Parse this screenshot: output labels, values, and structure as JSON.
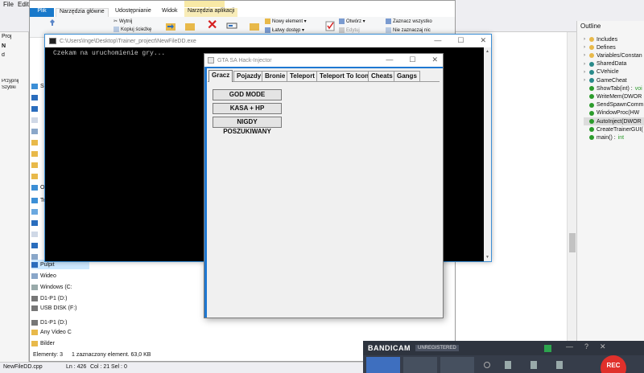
{
  "ide": {
    "menu": [
      "File",
      "Edit"
    ],
    "left_tabs": [
      "Proj",
      "N",
      "d",
      "Przypnij",
      "Szybki"
    ],
    "status": {
      "file": "NewFileDD.cpp",
      "line": "Ln : 426",
      "col": "Col : 21",
      "sel": "Sel : 0"
    }
  },
  "outline": {
    "title": "Outline",
    "items": [
      {
        "label": "Includes",
        "type": "folder"
      },
      {
        "label": "Defines",
        "type": "folder"
      },
      {
        "label": "Variables/Constan",
        "type": "folder"
      },
      {
        "label": "SharedData",
        "type": "struct"
      },
      {
        "label": "CVehicle",
        "type": "struct"
      },
      {
        "label": "GameCheat",
        "type": "struct"
      },
      {
        "label": "ShowTab(int) :",
        "ret": "voi",
        "type": "func"
      },
      {
        "label": "WriteMem(DWOR",
        "type": "func"
      },
      {
        "label": "SendSpawnComm",
        "type": "func"
      },
      {
        "label": "WindowProc(HW",
        "type": "func"
      },
      {
        "label": "AutoInject(DWOR",
        "type": "func",
        "selected": true
      },
      {
        "label": "CreateTrainerGUI(",
        "type": "func"
      },
      {
        "label": "main() :",
        "ret": "int",
        "type": "func"
      }
    ]
  },
  "explorer": {
    "ribbon_tabs": {
      "file": "Plik",
      "home": "Narzędzia główne",
      "share": "Udostępnianie",
      "view": "Widok",
      "apps": "Narzędzia aplikacji"
    },
    "ribbon": {
      "cut": "Wytnij",
      "copy_path": "Kopiuj ścieżkę",
      "new_item": "Nowy element ▾",
      "easy_access": "Łatwy dostęp ▾",
      "open": "Otwórz ▾",
      "edit": "Edytuj",
      "select_all": "Zaznacz wszystko",
      "select_none": "Nie zaznaczaj nic"
    },
    "nav": [
      {
        "label": "Sa",
        "top": 0
      },
      {
        "label": "O",
        "top": 0
      },
      {
        "label": "Te",
        "top": 0
      },
      {
        "label": "Pulpit",
        "top": 0,
        "selected": true
      },
      {
        "label": "Wideo",
        "top": 0
      },
      {
        "label": "Windows (C:",
        "top": 0
      },
      {
        "label": "D1-P1 (D:)",
        "top": 0
      },
      {
        "label": "USB DISK (F:)",
        "top": 0
      },
      {
        "label": "D1-P1 (D:)",
        "top": 0
      },
      {
        "label": "Any Video C",
        "top": 0
      },
      {
        "label": "Bilder",
        "top": 0
      }
    ],
    "status": {
      "count": "Elementy: 3",
      "selected": "1 zaznaczony element. 63,0 KB"
    }
  },
  "console": {
    "title": "C:\\Users\\Inge\\Desktop\\Trainer_project\\NewFileDD.exe",
    "output": "Czekam na uruchomienie gry...",
    "buttons": {
      "minimize": "—",
      "maximize": "☐",
      "close": "✕"
    }
  },
  "injector": {
    "title": "GTA SA Hack-Injector",
    "buttons_window": {
      "minimize": "—",
      "maximize": "☐",
      "close": "✕"
    },
    "tabs": [
      "Gracz",
      "Pojazdy",
      "Bronie",
      "Teleport",
      "Teleport To Icon",
      "Cheats",
      "Gangs"
    ],
    "active_tab": "Gracz",
    "actions": [
      "GOD MODE",
      "KASA + HP",
      "NIGDY POSZUKIWANY"
    ]
  },
  "bandicam": {
    "logo": "BANDICAM",
    "license": "UNREGISTERED",
    "rec": "REC",
    "window_btns": {
      "min": "—",
      "help": "?",
      "close": "✕"
    }
  },
  "colors": {
    "accent": "#1e78d2",
    "console_bg": "#000000",
    "rec": "#e0302b",
    "bandicam_bg": "#363d4a"
  }
}
